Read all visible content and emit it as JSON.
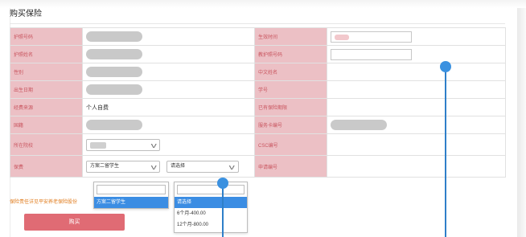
{
  "page": {
    "title": "购买保险"
  },
  "rows": [
    {
      "left_label": "护照号码",
      "right_label": "生效时间"
    },
    {
      "left_label": "护照姓名",
      "right_label": "教护照号码"
    },
    {
      "left_label": "性别",
      "right_label": "中文姓名"
    },
    {
      "left_label": "出生日期",
      "right_label": "学号"
    },
    {
      "left_label": "经费来源",
      "left_value": "个人自费",
      "right_label": "已有保险期限"
    },
    {
      "left_label": "国籍",
      "right_label": "服务卡编号"
    },
    {
      "left_label": "所在院校",
      "right_label": "CSC编号"
    },
    {
      "left_label": "保费",
      "right_label": "申请编号"
    }
  ],
  "plan_select": {
    "value": "方案二留学生",
    "options": [
      "方案二留学生"
    ]
  },
  "period_select": {
    "placeholder": "请选择",
    "options": [
      "请选择",
      "6个月-400.00",
      "12个月-800.00"
    ]
  },
  "notice": "保险责任详见平安养老保险股份",
  "buy_button": "购买",
  "colors": {
    "label_bg": "#ecc0c5",
    "label_text": "#c9555f",
    "button": "#e06b74",
    "highlight": "#3b8de3",
    "marker": "#3b91e0"
  },
  "icons": {
    "chevron": "chevron-down-icon",
    "marker": "blue-pin-marker"
  }
}
